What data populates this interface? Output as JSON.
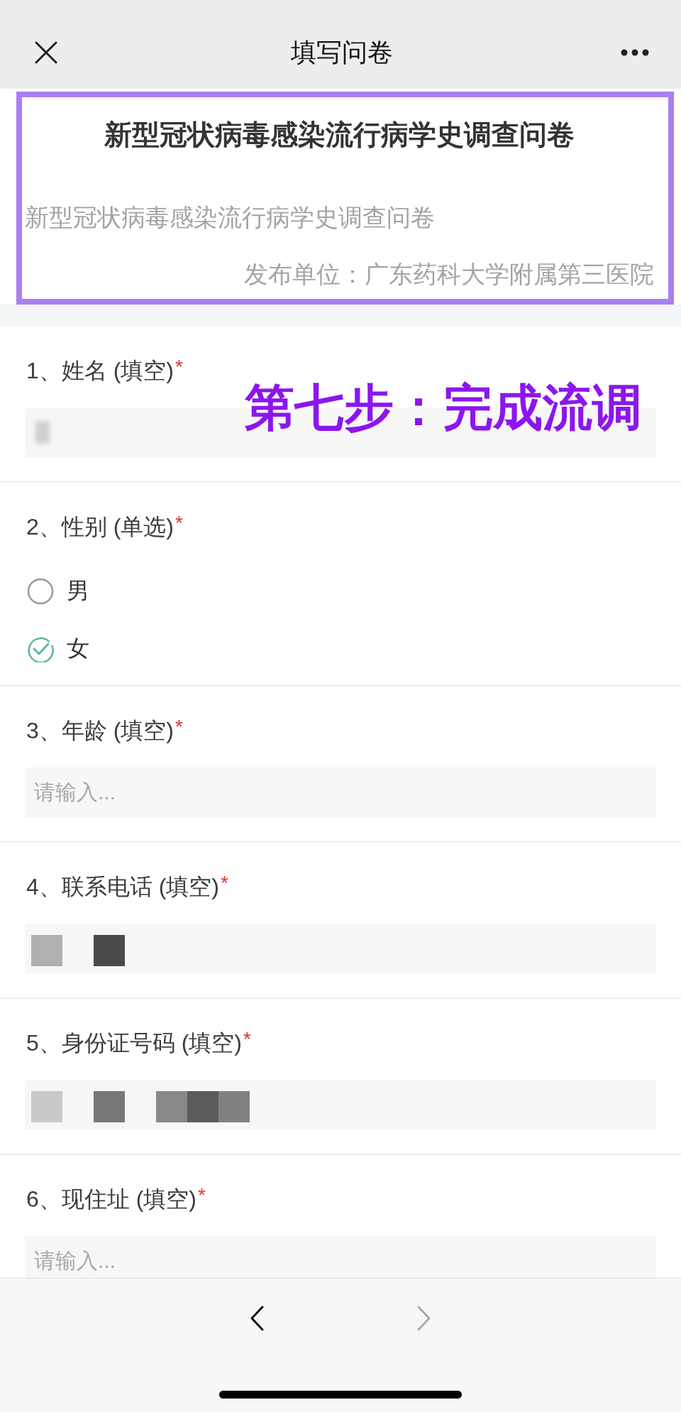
{
  "nav_bar": {
    "title": "填写问卷"
  },
  "header": {
    "title": "新型冠状病毒感染流行病学史调查问卷",
    "description": "新型冠状病毒感染流行病学史调查问卷",
    "publisher": "发布单位：广东药科大学附属第三医院"
  },
  "annotation": "第七步：完成流调",
  "questions": [
    {
      "kind": "text",
      "label": "1、姓名 (填空)",
      "required_mark": "*",
      "field": {
        "kind": "blur"
      }
    },
    {
      "kind": "choice",
      "label": "2、性别 (单选)",
      "required_mark": "*",
      "options": [
        {
          "label": "男",
          "selected": false
        },
        {
          "label": "女",
          "selected": true
        }
      ]
    },
    {
      "kind": "text",
      "label": "3、年龄 (填空)",
      "required_mark": "*",
      "field": {
        "kind": "input",
        "placeholder": "请输入..."
      }
    },
    {
      "kind": "text",
      "label": "4、联系电话 (填空)",
      "required_mark": "*",
      "field": {
        "kind": "mosaic"
      }
    },
    {
      "kind": "text",
      "label": "5、身份证号码 (填空)",
      "required_mark": "*",
      "field": {
        "kind": "mosaic"
      }
    },
    {
      "kind": "text",
      "label": "6、现住址 (填空)",
      "required_mark": "*",
      "field": {
        "kind": "input",
        "placeholder": "请输入..."
      }
    }
  ],
  "pager": [
    {
      "kind": "previous",
      "disabled": false
    },
    {
      "kind": "next",
      "disabled": true
    }
  ]
}
